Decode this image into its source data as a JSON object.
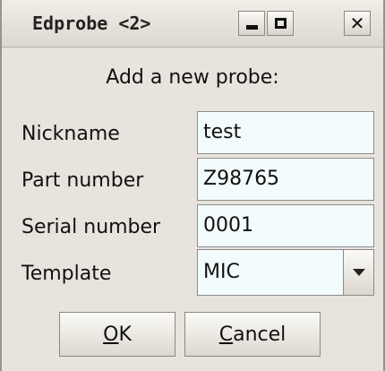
{
  "window": {
    "title": "Edprobe <2>",
    "controls": {
      "minimize_icon": "minimize-icon",
      "maximize_icon": "maximize-icon",
      "close_icon": "close-icon"
    }
  },
  "dialog": {
    "heading": "Add a new probe:",
    "fields": {
      "nickname": {
        "label": "Nickname",
        "value": "test"
      },
      "part_number": {
        "label": "Part number",
        "value": "Z98765"
      },
      "serial_number": {
        "label": "Serial number",
        "value": "0001"
      },
      "template": {
        "label": "Template",
        "value": "MIC"
      }
    },
    "buttons": {
      "ok": {
        "mnemonic": "O",
        "rest": "K"
      },
      "cancel": {
        "mnemonic": "C",
        "rest": "ancel"
      }
    }
  },
  "colors": {
    "background": "#e8e4dd",
    "field_background": "#f3fcfc",
    "border": "#8b8b8b"
  }
}
